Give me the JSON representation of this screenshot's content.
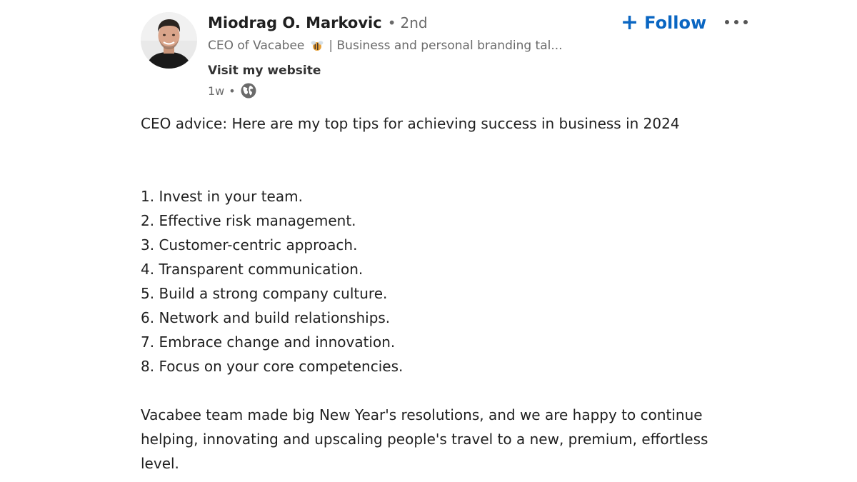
{
  "author": {
    "name": "Miodrag O. Markovic",
    "degree_separator": "•",
    "degree": "2nd",
    "headline_prefix": "CEO of Vacabee",
    "headline_suffix": "| Business and personal branding tal...",
    "website_label": "Visit my website",
    "timestamp": "1w",
    "meta_separator": "•",
    "visibility_icon": "globe-icon"
  },
  "actions": {
    "follow_label": "Follow",
    "follow_icon": "+",
    "follow_color": "#0a66c2",
    "more_icon": "more-horizontal-icon"
  },
  "post": {
    "intro": "CEO advice: Here are my top tips for achieving success in business in 2024",
    "tips": [
      "1. Invest in your team.",
      "2. Effective risk management.",
      "3. Customer-centric approach.",
      "4. Transparent communication.",
      "5. Build a strong company culture.",
      "6. Network and build relationships.",
      "7. Embrace change and innovation.",
      "8. Focus on your core competencies."
    ],
    "closing": "Vacabee team made big New Year's resolutions, and we are happy to continue helping, innovating and upscaling people's travel to a new, premium, effortless level."
  }
}
